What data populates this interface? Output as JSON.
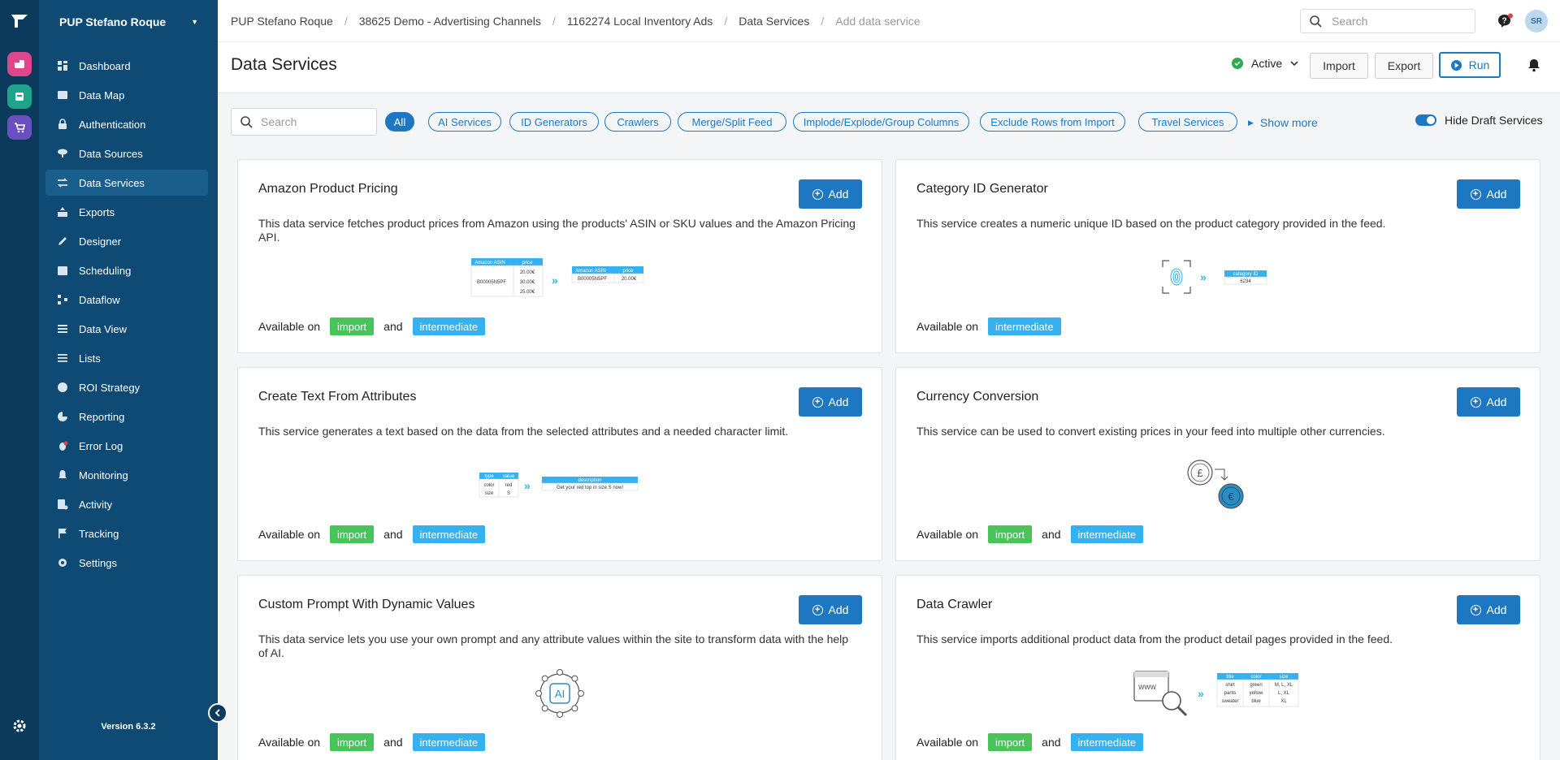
{
  "app": {
    "account": "PUP Stefano Roque",
    "version": "Version 6.3.2",
    "user_initials": "SR"
  },
  "nav": [
    {
      "label": "Dashboard",
      "icon": "dashboard-icon"
    },
    {
      "label": "Data Map",
      "icon": "map-icon"
    },
    {
      "label": "Authentication",
      "icon": "lock-icon"
    },
    {
      "label": "Data Sources",
      "icon": "cloud-download-icon"
    },
    {
      "label": "Data Services",
      "icon": "swap-icon",
      "active": true
    },
    {
      "label": "Exports",
      "icon": "export-icon"
    },
    {
      "label": "Designer",
      "icon": "pencil-icon"
    },
    {
      "label": "Scheduling",
      "icon": "calendar-icon"
    },
    {
      "label": "Dataflow",
      "icon": "dataflow-icon"
    },
    {
      "label": "Data View",
      "icon": "table-icon"
    },
    {
      "label": "Lists",
      "icon": "list-icon"
    },
    {
      "label": "ROI Strategy",
      "icon": "dollar-icon"
    },
    {
      "label": "Reporting",
      "icon": "pie-chart-icon"
    },
    {
      "label": "Error Log",
      "icon": "bug-icon"
    },
    {
      "label": "Monitoring",
      "icon": "bell-icon"
    },
    {
      "label": "Activity",
      "icon": "activity-icon"
    },
    {
      "label": "Tracking",
      "icon": "flag-icon"
    },
    {
      "label": "Settings",
      "icon": "gear-icon"
    }
  ],
  "breadcrumbs": [
    "PUP Stefano Roque",
    "38625 Demo - Advertising Channels",
    "1162274 Local Inventory Ads",
    "Data Services",
    "Add data service"
  ],
  "topbar": {
    "search_placeholder": "Search"
  },
  "header": {
    "title": "Data Services",
    "status": "Active",
    "import_label": "Import",
    "export_label": "Export",
    "run_label": "Run"
  },
  "filters": {
    "search_placeholder": "Search",
    "chips": [
      "All",
      "AI Services",
      "ID Generators",
      "Crawlers",
      "Merge/Split Feed",
      "Implode/Explode/Group Columns",
      "Exclude Rows from Import",
      "Travel Services"
    ],
    "show_more": "Show more",
    "hide_drafts": "Hide Draft Services"
  },
  "card_common": {
    "add_label": "Add",
    "available_on": "Available on",
    "and": "and",
    "import": "import",
    "intermediate": "intermediate"
  },
  "cards": [
    {
      "title": "Amazon Product Pricing",
      "desc": "This data service fetches product prices from Amazon using the products' ASIN or SKU values and the Amazon Pricing API.",
      "import": true,
      "illustration": {
        "left_headers": [
          "Amazon ASIN",
          "price"
        ],
        "left_asin": "B00005N5PF",
        "left_prices": [
          "20.00€",
          "30.00€",
          "25.00€"
        ],
        "right_headers": [
          "Amazon ASIN",
          "price"
        ],
        "right_row": [
          "B00005N5PF",
          "20.00€"
        ]
      }
    },
    {
      "title": "Category ID Generator",
      "desc": "This service creates a numeric unique ID based on the product category provided in the feed.",
      "import": false,
      "illustration": {
        "header": "category ID",
        "value": "6234"
      }
    },
    {
      "title": "Create Text From Attributes",
      "desc": "This service generates a text based on the data from the selected attributes and a needed character limit.",
      "import": true,
      "illustration": {
        "headers": [
          "type",
          "value"
        ],
        "rows": [
          [
            "color",
            "red"
          ],
          [
            "size",
            "S"
          ]
        ],
        "out_header": "description",
        "out_value": "Get your red top in size S now!"
      }
    },
    {
      "title": "Currency Conversion",
      "desc": "This service can be used to convert existing prices in your feed into multiple other currencies.",
      "import": true,
      "illustration": {
        "from": "£",
        "to": "€"
      }
    },
    {
      "title": "Custom Prompt With Dynamic Values",
      "desc": "This data service lets you use your own prompt and any attribute values within the site to transform data with the help of AI.",
      "import": true,
      "illustration": {
        "label": "AI"
      }
    },
    {
      "title": "Data Crawler",
      "desc": "This service imports additional product data from the product detail pages provided in the feed.",
      "import": true,
      "illustration": {
        "www": "www",
        "headers": [
          "title",
          "color",
          "size"
        ],
        "rows": [
          [
            "shirt",
            "green",
            "M, L, XL"
          ],
          [
            "pants",
            "yellow",
            "L, XL"
          ],
          [
            "sweater",
            "blue",
            "XL"
          ]
        ]
      }
    }
  ],
  "colors": {
    "primary": "#1d78c1",
    "sidebar": "#0e4a73",
    "import": "#47c45a",
    "intermediate": "#35b0f0",
    "active": "#2dab4f"
  }
}
